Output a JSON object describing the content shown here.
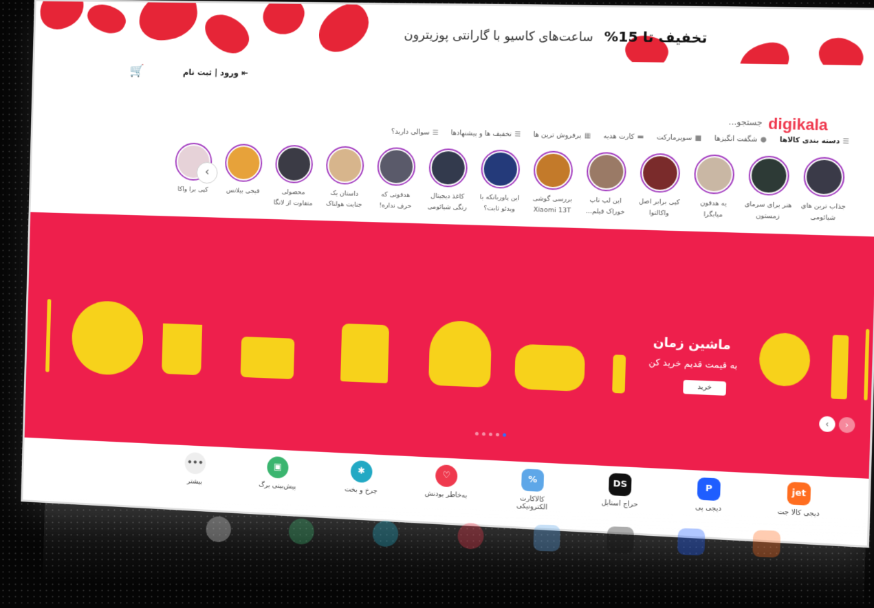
{
  "promo": {
    "headline": "تخفیف تا 15%",
    "text": "ساعت‌های کاسیو با گارانتی پوزیترون"
  },
  "header": {
    "logo": "digikala",
    "search_placeholder": "جستجو...",
    "login_label": "ورود | ثبت نام"
  },
  "nav": {
    "categories": "دسته بندی کالاها",
    "items": [
      "شگفت انگیزها",
      "سوپرمارکت",
      "کارت هدیه",
      "پرفروش ترین ها",
      "تخفیف ها و پیشنهادها",
      "سوالی دارید؟"
    ]
  },
  "stories": [
    {
      "label": "جذاب ترین های شیائومی",
      "color": "#3a3a48"
    },
    {
      "label": "هنر برای سرمای زمستون",
      "color": "#2d3a36"
    },
    {
      "label": "یه هدفون میابگرا",
      "color": "#c9b7a4"
    },
    {
      "label": "کپی برابر اصل واکالتوا",
      "color": "#7a2b2b"
    },
    {
      "label": "این لپ تاپ خوراک فیلم...",
      "color": "#9a7a66"
    },
    {
      "label": "بررسی گوشی Xiaomi 13T",
      "color": "#c37a2a"
    },
    {
      "label": "این پاوربانکه با ویدئو ثابت؟",
      "color": "#243a7a"
    },
    {
      "label": "کاغذ دیجیتال رنگی شیائومی",
      "color": "#333a4d"
    },
    {
      "label": "هدفونی که حرف نداره!",
      "color": "#5a5a6a"
    },
    {
      "label": "داستان یک جنایت هولناک",
      "color": "#d7b58c"
    },
    {
      "label": "محصولی متفاوت از لانگا",
      "color": "#3b3b45"
    },
    {
      "label": "فیجی بیلانس",
      "color": "#e7a23a"
    },
    {
      "label": "کپی برا واکا",
      "color": "#e6d2d8"
    }
  ],
  "hero": {
    "title": "ماشین زمان",
    "subtitle": "به قیمت قدیم خرید کن",
    "button": "خرید"
  },
  "services": [
    {
      "label": "دیجی کالا جت",
      "icon": "jet",
      "color": "#ff6d1f"
    },
    {
      "label": "دیجی پی",
      "icon": "pay",
      "color": "#1f5eff"
    },
    {
      "label": "حراج استایل",
      "icon": "DS",
      "color": "#111111"
    },
    {
      "label": "کالاکارت الکترونیکی",
      "icon": "%",
      "color": "#5ea7e8"
    },
    {
      "label": "به‌خاطر بودنش",
      "icon": "heart",
      "color": "#ef394e"
    },
    {
      "label": "چرخ و بخت",
      "icon": "wheel",
      "color": "#22a9c4"
    },
    {
      "label": "پیش‌بینی برگ",
      "icon": "field",
      "color": "#3bb56f"
    },
    {
      "label": "بیشتر",
      "icon": "more",
      "color": "#eeeeee"
    }
  ]
}
